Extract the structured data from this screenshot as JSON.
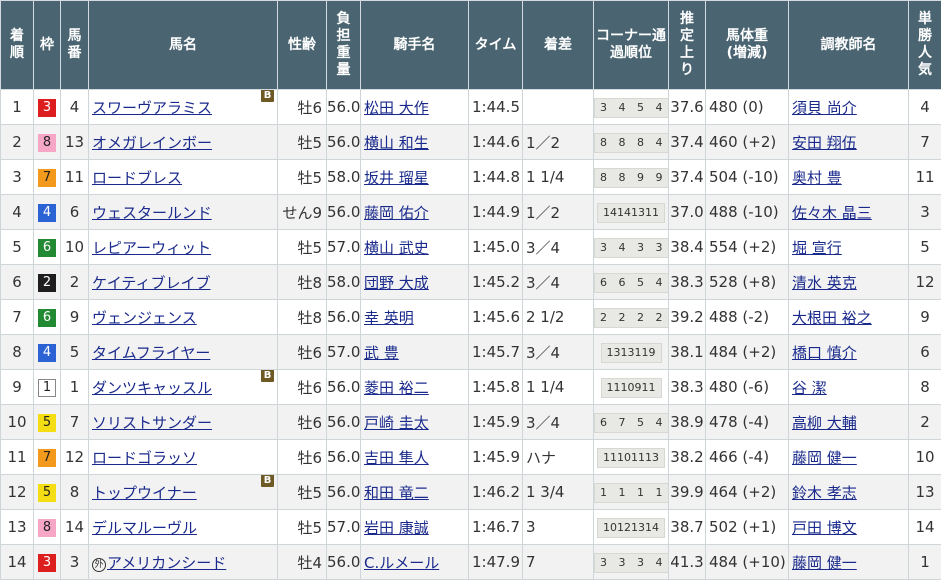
{
  "headers": {
    "rank": "着順",
    "frame": "枠",
    "number": "馬番",
    "horse": "馬名",
    "sexage": "性齢",
    "weight": "負担重量",
    "jockey": "騎手名",
    "time": "タイム",
    "margin": "着差",
    "corner": "コーナー通過順位",
    "last3f": "推定上り",
    "body": "馬体重(増減)",
    "trainer": "調教師名",
    "pop": "単勝人気"
  },
  "blinker_label": "B",
  "foreign_label": "外",
  "frame_colors": {
    "1": "#ffffff",
    "2": "#1e1e1e",
    "3": "#dd1e1e",
    "4": "#2b63d4",
    "5": "#f4de13",
    "6": "#238a34",
    "7": "#f39a1c",
    "8": "#f7a7c6"
  },
  "rows": [
    {
      "rank": "1",
      "frame": "3",
      "number": "4",
      "horse": "スワーヴアラミス",
      "blinker": true,
      "foreign": false,
      "sexage": "牡6",
      "weight": "56.0",
      "jockey": "松田 大作",
      "time": "1:44.5",
      "margin": "",
      "corner": "3 4 5 4",
      "last3f": "37.6",
      "body": "480 (0)",
      "trainer": "須貝 尚介",
      "pop": "4"
    },
    {
      "rank": "2",
      "frame": "8",
      "number": "13",
      "horse": "オメガレインボー",
      "blinker": false,
      "foreign": false,
      "sexage": "牡5",
      "weight": "56.0",
      "jockey": "横山 和生",
      "time": "1:44.6",
      "margin": "1／2",
      "corner": "8 8 8 4",
      "last3f": "37.4",
      "body": "460 (+2)",
      "trainer": "安田 翔伍",
      "pop": "7"
    },
    {
      "rank": "3",
      "frame": "7",
      "number": "11",
      "horse": "ロードブレス",
      "blinker": false,
      "foreign": false,
      "sexage": "牡5",
      "weight": "58.0",
      "jockey": "坂井 瑠星",
      "time": "1:44.8",
      "margin": "1 1/4",
      "corner": "8 8 9 9",
      "last3f": "37.4",
      "body": "504 (-10)",
      "trainer": "奥村 豊",
      "pop": "11"
    },
    {
      "rank": "4",
      "frame": "4",
      "number": "6",
      "horse": "ウェスタールンド",
      "blinker": false,
      "foreign": false,
      "sexage": "せん9",
      "weight": "56.0",
      "jockey": "藤岡 佑介",
      "time": "1:44.9",
      "margin": "1／2",
      "corner": "14141311",
      "last3f": "37.0",
      "body": "488 (-10)",
      "trainer": "佐々木 晶三",
      "pop": "3"
    },
    {
      "rank": "5",
      "frame": "6",
      "number": "10",
      "horse": "レピアーウィット",
      "blinker": false,
      "foreign": false,
      "sexage": "牡5",
      "weight": "57.0",
      "jockey": "横山 武史",
      "time": "1:45.0",
      "margin": "3／4",
      "corner": "3 4 3 3",
      "last3f": "38.4",
      "body": "554 (+2)",
      "trainer": "堀 宣行",
      "pop": "5"
    },
    {
      "rank": "6",
      "frame": "2",
      "number": "2",
      "horse": "ケイティブレイブ",
      "blinker": false,
      "foreign": false,
      "sexage": "牡8",
      "weight": "58.0",
      "jockey": "団野 大成",
      "time": "1:45.2",
      "margin": "3／4",
      "corner": "6 6 5 4",
      "last3f": "38.3",
      "body": "528 (+8)",
      "trainer": "清水 英克",
      "pop": "12"
    },
    {
      "rank": "7",
      "frame": "6",
      "number": "9",
      "horse": "ヴェンジェンス",
      "blinker": false,
      "foreign": false,
      "sexage": "牡8",
      "weight": "56.0",
      "jockey": "幸 英明",
      "time": "1:45.6",
      "margin": "2 1/2",
      "corner": "2 2 2 2",
      "last3f": "39.2",
      "body": "488 (-2)",
      "trainer": "大根田 裕之",
      "pop": "9"
    },
    {
      "rank": "8",
      "frame": "4",
      "number": "5",
      "horse": "タイムフライヤー",
      "blinker": false,
      "foreign": false,
      "sexage": "牡6",
      "weight": "57.0",
      "jockey": "武 豊",
      "time": "1:45.7",
      "margin": "3／4",
      "corner": "1313119",
      "last3f": "38.1",
      "body": "484 (+2)",
      "trainer": "橋口 慎介",
      "pop": "6"
    },
    {
      "rank": "9",
      "frame": "1",
      "number": "1",
      "horse": "ダンツキャッスル",
      "blinker": true,
      "foreign": false,
      "sexage": "牡6",
      "weight": "56.0",
      "jockey": "菱田 裕二",
      "time": "1:45.8",
      "margin": "1 1/4",
      "corner": "1110911",
      "last3f": "38.3",
      "body": "480 (-6)",
      "trainer": "谷 潔",
      "pop": "8"
    },
    {
      "rank": "10",
      "frame": "5",
      "number": "7",
      "horse": "ソリストサンダー",
      "blinker": false,
      "foreign": false,
      "sexage": "牡6",
      "weight": "56.0",
      "jockey": "戸崎 圭太",
      "time": "1:45.9",
      "margin": "3／4",
      "corner": "6 7 5 4",
      "last3f": "38.9",
      "body": "478 (-4)",
      "trainer": "高柳 大輔",
      "pop": "2"
    },
    {
      "rank": "11",
      "frame": "7",
      "number": "12",
      "horse": "ロードゴラッソ",
      "blinker": false,
      "foreign": false,
      "sexage": "牡6",
      "weight": "56.0",
      "jockey": "吉田 隼人",
      "time": "1:45.9",
      "margin": "ハナ",
      "corner": "11101113",
      "last3f": "38.2",
      "body": "466 (-4)",
      "trainer": "藤岡 健一",
      "pop": "10"
    },
    {
      "rank": "12",
      "frame": "5",
      "number": "8",
      "horse": "トップウイナー",
      "blinker": true,
      "foreign": false,
      "sexage": "牡5",
      "weight": "56.0",
      "jockey": "和田 竜二",
      "time": "1:46.2",
      "margin": "1 3/4",
      "corner": "1 1 1 1",
      "last3f": "39.9",
      "body": "464 (+2)",
      "trainer": "鈴木 孝志",
      "pop": "13"
    },
    {
      "rank": "13",
      "frame": "8",
      "number": "14",
      "horse": "デルマルーヴル",
      "blinker": false,
      "foreign": false,
      "sexage": "牡5",
      "weight": "57.0",
      "jockey": "岩田 康誠",
      "time": "1:46.7",
      "margin": "3",
      "corner": "10121314",
      "last3f": "38.7",
      "body": "502 (+1)",
      "trainer": "戸田 博文",
      "pop": "14"
    },
    {
      "rank": "14",
      "frame": "3",
      "number": "3",
      "horse": "アメリカンシード",
      "blinker": false,
      "foreign": true,
      "sexage": "牡4",
      "weight": "56.0",
      "jockey": "C.ルメール",
      "time": "1:47.9",
      "margin": "7",
      "corner": "3 3 3 4",
      "last3f": "41.3",
      "body": "484 (+10)",
      "trainer": "藤岡 健一",
      "pop": "1"
    }
  ]
}
